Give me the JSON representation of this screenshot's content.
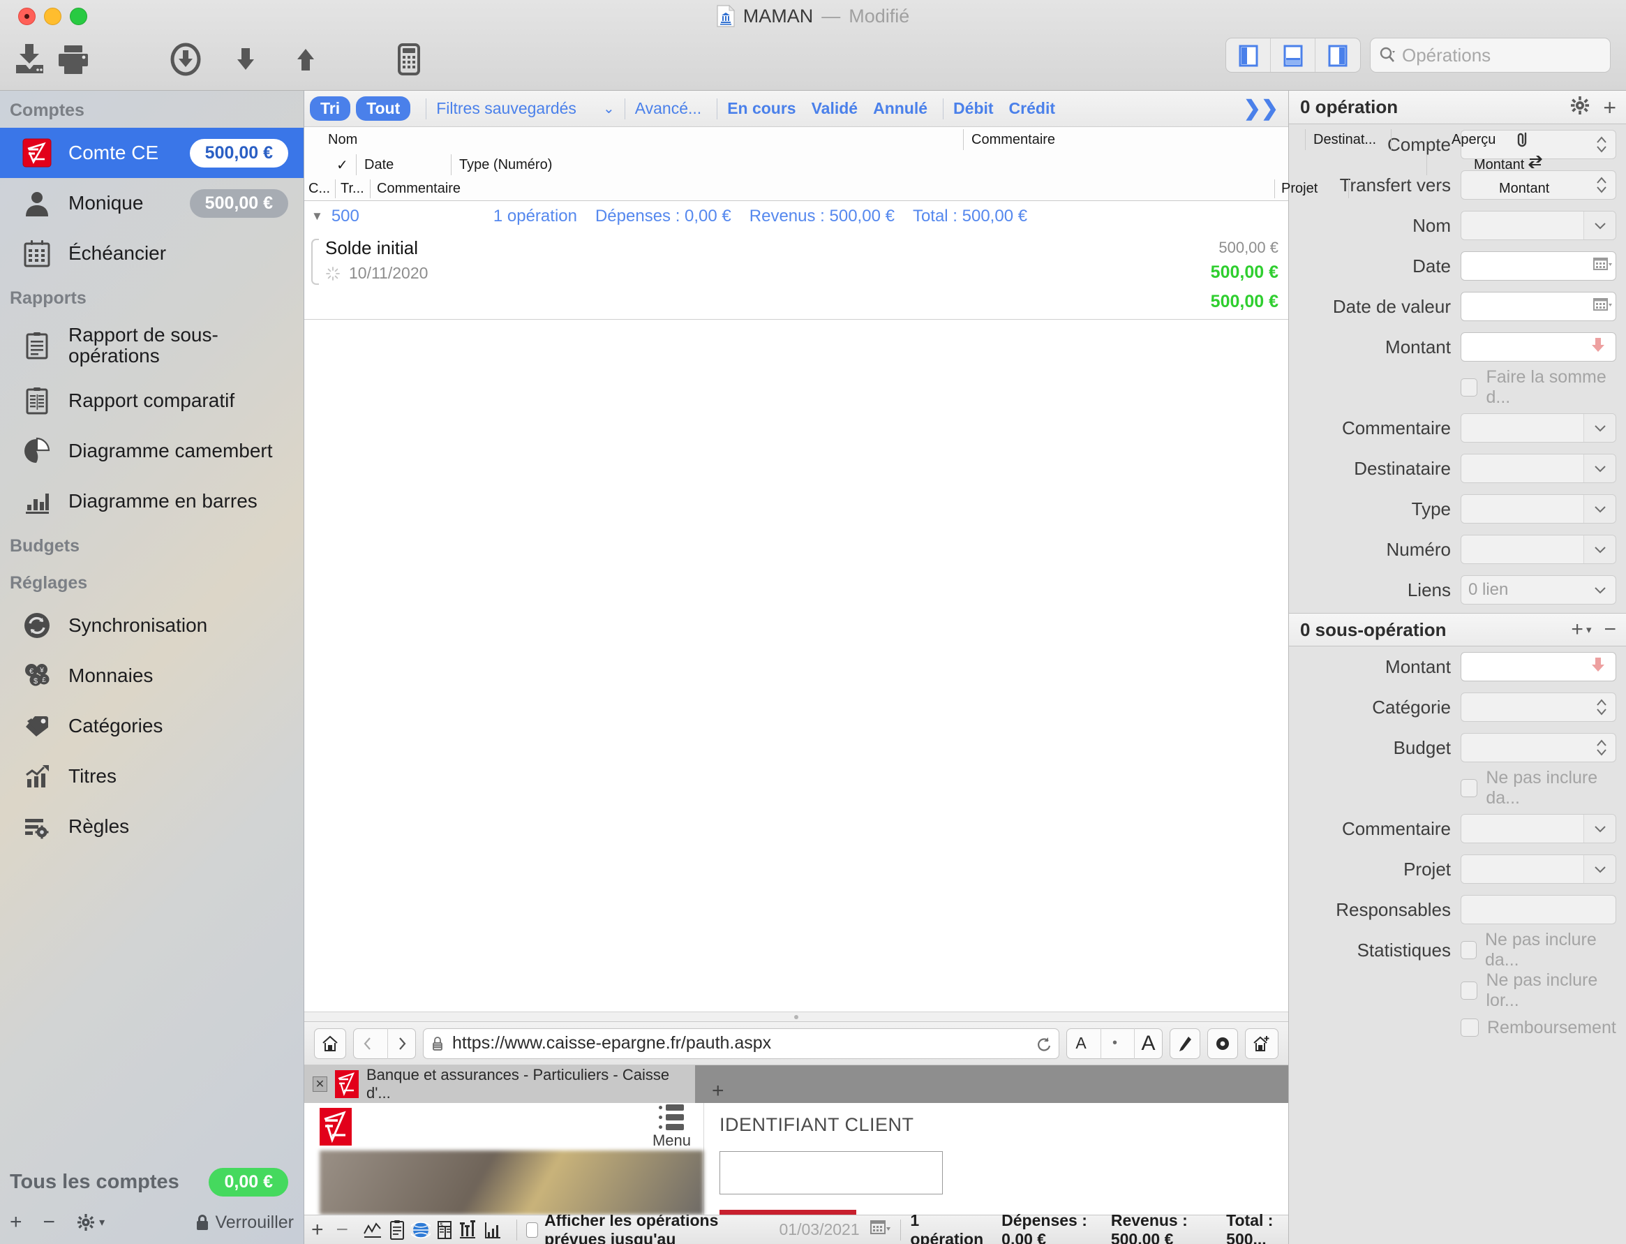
{
  "window": {
    "title": "MAMAN",
    "modified_label": "Modifié",
    "separator": "—",
    "doc_icon": "bank-document-icon"
  },
  "toolbar": {
    "buttons": [
      {
        "name": "import-file-button",
        "icon": "download-to-tray-icon"
      },
      {
        "name": "print-button",
        "icon": "printer-icon"
      },
      {
        "name": "download-operations-button",
        "icon": "circle-arrow-down-icon"
      },
      {
        "name": "collapse-button",
        "icon": "arrow-down-icon"
      },
      {
        "name": "expand-button",
        "icon": "arrow-up-icon"
      },
      {
        "name": "calculator-button",
        "icon": "calculator-icon"
      }
    ],
    "view_modes": [
      {
        "name": "view-mode-left-panel",
        "icon": "panel-left-icon",
        "active": true
      },
      {
        "name": "view-mode-bottom-panel",
        "icon": "panel-bottom-icon",
        "active": true
      },
      {
        "name": "view-mode-right-panel",
        "icon": "panel-right-icon",
        "active": true
      }
    ],
    "search": {
      "placeholder": "Opérations",
      "value": "",
      "icon": "search-icon"
    }
  },
  "sidebar": {
    "sections": [
      {
        "title": "Comptes"
      },
      {
        "title": "Rapports"
      },
      {
        "title": "Budgets"
      },
      {
        "title": "Réglages"
      }
    ],
    "comptes": [
      {
        "label": "Comte CE",
        "badge": "500,00 €",
        "icon": "caisse-epargne-logo-icon",
        "selected": true
      },
      {
        "label": "Monique",
        "badge": "500,00 €",
        "icon": "person-icon",
        "selected": false
      },
      {
        "label": "Échéancier",
        "badge": "",
        "icon": "calendar-icon",
        "selected": false
      }
    ],
    "rapports": [
      {
        "label": "Rapport de sous-opérations",
        "icon": "clipboard-list-icon"
      },
      {
        "label": "Rapport comparatif",
        "icon": "clipboard-compare-icon"
      },
      {
        "label": "Diagramme camembert",
        "icon": "pie-chart-icon"
      },
      {
        "label": "Diagramme en barres",
        "icon": "bar-chart-icon"
      }
    ],
    "reglages": [
      {
        "label": "Synchronisation",
        "icon": "sync-icon"
      },
      {
        "label": "Monnaies",
        "icon": "coins-icon"
      },
      {
        "label": "Catégories",
        "icon": "tag-icon"
      },
      {
        "label": "Titres",
        "icon": "trending-up-icon"
      },
      {
        "label": "Règles",
        "icon": "rules-gear-icon"
      }
    ],
    "footer": {
      "total_label": "Tous les comptes",
      "total_value": "0,00 €",
      "add": "+",
      "remove": "−",
      "settings_icon": "gear-icon",
      "lock_label": "Verrouiller",
      "lock_icon": "lock-icon"
    }
  },
  "filterbar": {
    "pills": [
      "Tri",
      "Tout"
    ],
    "saved_filters_label": "Filtres sauvegardés",
    "advanced_label": "Avancé...",
    "states": [
      "En cours",
      "Validé",
      "Annulé"
    ],
    "flow": [
      "Débit",
      "Crédit"
    ],
    "overflow_icon": "double-chevron-right-icon"
  },
  "table": {
    "header_row1": [
      "Nom",
      "Commentaire",
      "Destinat...",
      "Aperçu"
    ],
    "header_row1_icon": "paperclip-icon",
    "header_row2": [
      "✓",
      "Date",
      "Type (Numéro)",
      "Montant"
    ],
    "header_row2_icon": "transfer-arrows-icon",
    "header_row3": [
      "C...",
      "Tr...",
      "Commentaire",
      "Projet",
      "Montant"
    ],
    "group": {
      "name": "500",
      "count": "1 opération",
      "expenses": "Dépenses : 0,00 €",
      "revenue": "Revenus : 500,00 €",
      "total": "Total : 500,00 €",
      "expanded": true
    },
    "rows": [
      {
        "name": "Solde initial",
        "date": "10/11/2020",
        "amount_gray": "500,00 €",
        "amount_green": "500,00 €",
        "status_icon": "pending-spinner-icon"
      }
    ],
    "footer_total": "500,00 €"
  },
  "browser": {
    "nav": {
      "home_icon": "home-icon",
      "back_icon": "chevron-left-icon",
      "forward_icon": "chevron-right-icon",
      "lock_icon": "padlock-icon",
      "url": "https://www.caisse-epargne.fr/pauth.aspx",
      "reload_icon": "reload-icon",
      "font_small": "A",
      "font_dot": "•",
      "font_large": "A",
      "edit_icon": "pencil-icon",
      "record_icon": "record-circle-icon",
      "add_home_icon": "home-plus-icon"
    },
    "tab": {
      "title": "Banque et assurances - Particuliers - Caisse d'...",
      "close_icon": "close-icon",
      "favicon": "caisse-epargne-logo-icon",
      "new_tab": "+"
    },
    "page": {
      "logo": "caisse-epargne-logo-icon",
      "menu_label": "Menu",
      "menu_icon": "hamburger-list-icon",
      "form_title": "IDENTIFIANT CLIENT",
      "input_value": "",
      "submit_label": ""
    }
  },
  "inspector": {
    "operation": {
      "header": "0 opération",
      "gear_icon": "gear-icon",
      "add_icon": "plus-icon",
      "fields": [
        {
          "label": "Compte",
          "value": "",
          "control": "stepper"
        },
        {
          "label": "Transfert vers",
          "value": "",
          "control": "stepper"
        },
        {
          "label": "Nom",
          "value": "",
          "control": "combo"
        },
        {
          "label": "Date",
          "value": "",
          "control": "calendar"
        },
        {
          "label": "Date de valeur",
          "value": "",
          "control": "calendar"
        },
        {
          "label": "Montant",
          "value": "",
          "control": "amount-arrow"
        }
      ],
      "sum_checkbox": {
        "label": "Faire la somme d...",
        "checked": false
      },
      "fields2": [
        {
          "label": "Commentaire",
          "value": "",
          "control": "combo"
        },
        {
          "label": "Destinataire",
          "value": "",
          "control": "combo"
        },
        {
          "label": "Type",
          "value": "",
          "control": "combo"
        },
        {
          "label": "Numéro",
          "value": "",
          "control": "combo"
        },
        {
          "label": "Liens",
          "value": "0 lien",
          "control": "chevron"
        }
      ]
    },
    "suboperation": {
      "header": "0 sous-opération",
      "add_icon": "plus-dropdown-icon",
      "remove_icon": "minus-icon",
      "fields": [
        {
          "label": "Montant",
          "value": "",
          "control": "amount-arrow"
        },
        {
          "label": "Catégorie",
          "value": "",
          "control": "stepper"
        },
        {
          "label": "Budget",
          "value": "",
          "control": "stepper"
        }
      ],
      "exclude_checkbox": {
        "label": "Ne pas inclure da...",
        "checked": false
      },
      "fields2": [
        {
          "label": "Commentaire",
          "value": "",
          "control": "combo"
        },
        {
          "label": "Projet",
          "value": "",
          "control": "combo"
        },
        {
          "label": "Responsables",
          "value": "",
          "control": "plain"
        }
      ],
      "statistics_label": "Statistiques",
      "statistics_checkboxes": [
        {
          "label": "Ne pas inclure da...",
          "checked": false
        },
        {
          "label": "Ne pas inclure lor...",
          "checked": false
        },
        {
          "label": "Remboursement",
          "checked": false
        }
      ]
    }
  },
  "statusbar": {
    "add": "+",
    "remove": "−",
    "icons": [
      {
        "name": "chart-line-icon"
      },
      {
        "name": "clipboard-icon"
      },
      {
        "name": "globe-icon"
      },
      {
        "name": "currency-table-icon"
      },
      {
        "name": "compare-icon"
      },
      {
        "name": "histogram-icon"
      }
    ],
    "scheduled_checkbox": {
      "label": "Afficher les opérations prévues jusqu'au",
      "checked": false
    },
    "scheduled_date": "01/03/2021",
    "calendar_icon": "calendar-dropdown-icon",
    "summary": {
      "count": "1 opération",
      "expenses": "Dépenses : 0,00 €",
      "revenue": "Revenus : 500,00 €",
      "total": "Total : 500..."
    }
  },
  "colors": {
    "accent_blue": "#3a76e8",
    "filter_blue": "#4a80ea",
    "link_blue": "#5588ee",
    "green": "#2fce2f",
    "badge_green": "#45d95e",
    "caisse_red": "#e2001a",
    "submit_red": "#c8202e",
    "amount_arrow_pink": "#eda0a0"
  }
}
